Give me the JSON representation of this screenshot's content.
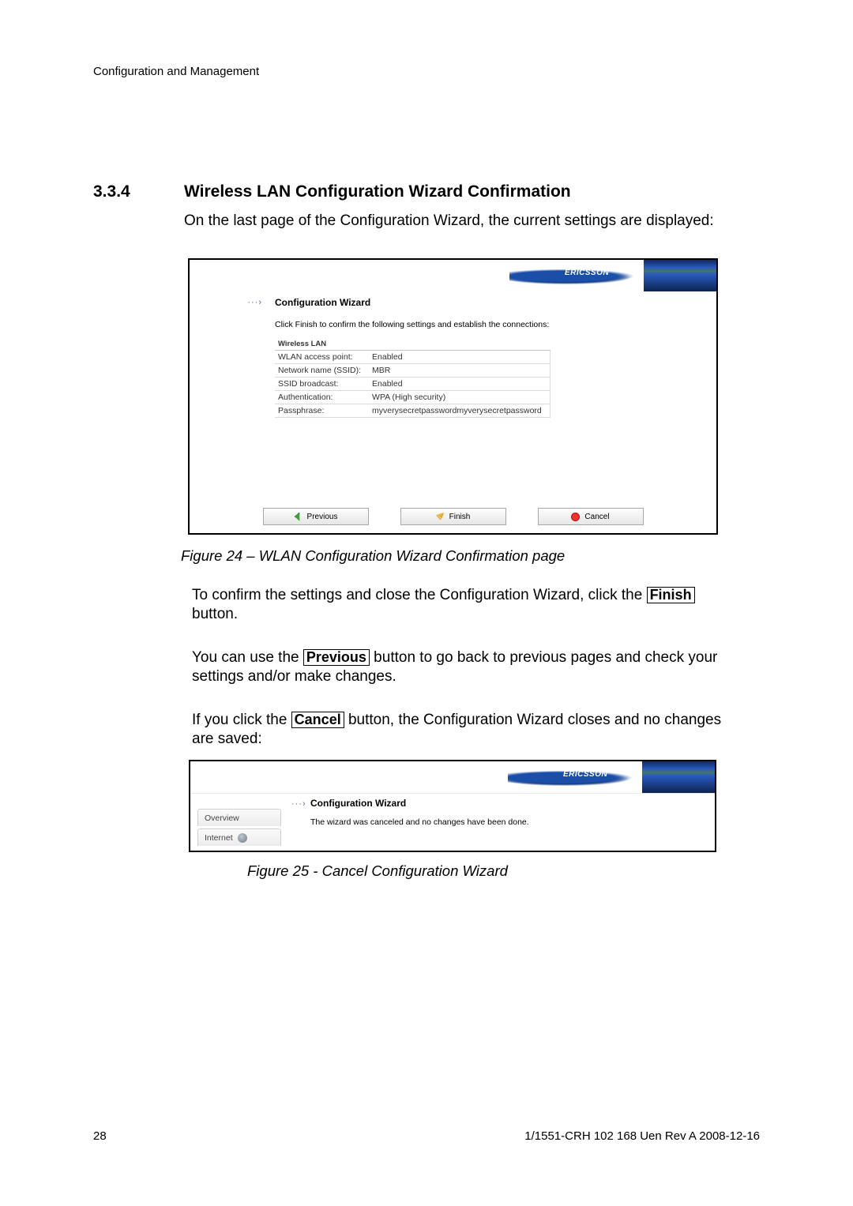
{
  "header": "Configuration and Management",
  "section": {
    "number": "3.3.4",
    "title": "Wireless LAN Configuration Wizard Confirmation"
  },
  "para1": "On the last page of the Configuration Wizard, the current settings are displayed:",
  "fig24": {
    "brand": "ERICSSON",
    "arrow_glyph": "···›",
    "wizard_title": "Configuration Wizard",
    "instruction": "Click Finish to confirm the following settings and establish the connections:",
    "table_header": "Wireless LAN",
    "rows": [
      {
        "label": "WLAN access point:",
        "value": "Enabled"
      },
      {
        "label": "Network name (SSID):",
        "value": "MBR"
      },
      {
        "label": "SSID broadcast:",
        "value": "Enabled"
      },
      {
        "label": "Authentication:",
        "value": "WPA (High security)"
      },
      {
        "label": "Passphrase:",
        "value": "myverysecretpasswordmyverysecretpassword"
      }
    ],
    "prev_label": "Previous",
    "finish_label": "Finish",
    "cancel_label": "Cancel"
  },
  "caption24": "Figure 24 – WLAN Configuration Wizard Confirmation page",
  "para2a": "To confirm the settings and close the Configuration Wizard, click the ",
  "para2b": " button.",
  "finish_key": "Finish",
  "para3a": "You can use the ",
  "previous_key": "Previous",
  "para3b": " button to go back to previous pages and check your settings and/or make changes.",
  "para4a": "If you click the ",
  "cancel_key": "Cancel",
  "para4b": " button, the Configuration Wizard closes and no changes are saved:",
  "fig25": {
    "brand": "ERICSSON",
    "arrow_glyph": "···›",
    "wizard_title": "Configuration Wizard",
    "message": "The wizard was canceled and no changes have been done.",
    "tab_overview": "Overview",
    "tab_internet": "Internet"
  },
  "caption25": "Figure 25 - Cancel Configuration Wizard",
  "page_number": "28",
  "footer_right": "1/1551-CRH 102 168 Uen Rev A  2008-12-16"
}
